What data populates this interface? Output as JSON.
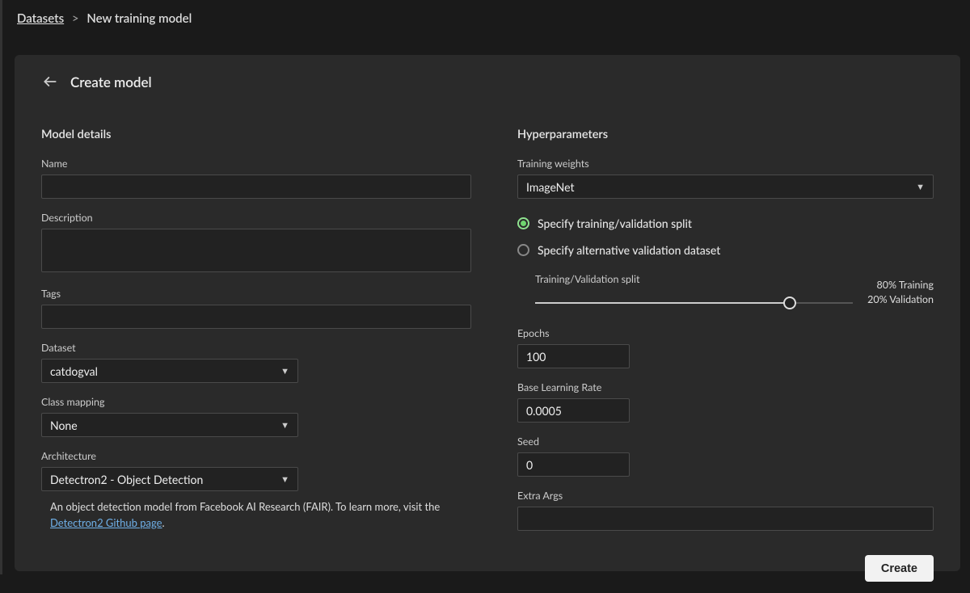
{
  "breadcrumb": {
    "root": "Datasets",
    "separator": ">",
    "current": "New training model"
  },
  "panel": {
    "title": "Create model",
    "sections": {
      "left_title": "Model details",
      "right_title": "Hyperparameters"
    },
    "fields": {
      "name_label": "Name",
      "name_value": "",
      "description_label": "Description",
      "description_value": "",
      "tags_label": "Tags",
      "tags_value": "",
      "dataset_label": "Dataset",
      "dataset_value": "catdogval",
      "class_mapping_label": "Class mapping",
      "class_mapping_value": "None",
      "architecture_label": "Architecture",
      "architecture_value": "Detectron2 - Object Detection",
      "architecture_desc_prefix": "An object detection model from Facebook AI Research (FAIR). To learn more, visit the ",
      "architecture_link_text": "Detectron2 Github page",
      "architecture_desc_suffix": "."
    },
    "hyper": {
      "training_weights_label": "Training weights",
      "training_weights_value": "ImageNet",
      "radio_split_label": "Specify training/validation split",
      "radio_alt_label": "Specify alternative validation dataset",
      "radio_selected": "split",
      "split_label": "Training/Validation split",
      "split_percent": 80,
      "split_readout_train": "80% Training",
      "split_readout_val": "20% Validation",
      "epochs_label": "Epochs",
      "epochs_value": "100",
      "lr_label": "Base Learning Rate",
      "lr_value": "0.0005",
      "seed_label": "Seed",
      "seed_value": "0",
      "extra_args_label": "Extra Args",
      "extra_args_value": ""
    },
    "footer": {
      "create_label": "Create"
    }
  },
  "colors": {
    "accent_green": "#6fd66f",
    "link": "#6fb0e8",
    "panel_bg": "#2a2a2a",
    "page_bg": "#1a1a1a",
    "button_bg": "#f2f2f2"
  }
}
